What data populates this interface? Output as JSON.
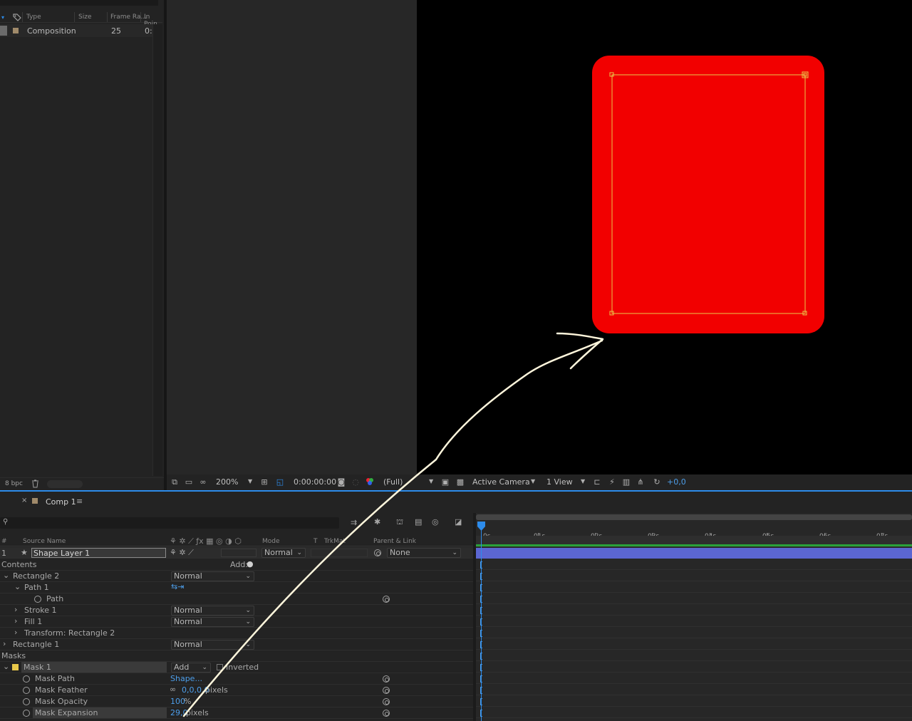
{
  "project": {
    "columns": {
      "type": "Type",
      "size": "Size",
      "frame_rate": "Frame Ra...",
      "in_point": "In Poin"
    },
    "items": [
      {
        "name": "Composition",
        "frame_rate": "25",
        "in_point": "0:"
      }
    ],
    "bpc": "8 bpc"
  },
  "viewer_toolbar": {
    "zoom": "200%",
    "timecode": "0:00:00:00",
    "resolution": "(Full)",
    "camera": "Active Camera",
    "views": "1 View",
    "exposure": "+0,0"
  },
  "timeline": {
    "comp_tab": "Comp 1",
    "columns": {
      "num": "#",
      "source_name": "Source Name",
      "mode": "Mode",
      "t": "T",
      "trkmat": "TrkMat",
      "parent": "Parent & Link"
    },
    "time_ticks": [
      "0s",
      "01s",
      "02s",
      "03s",
      "04s",
      "05s",
      "06s",
      "07s"
    ],
    "layer": {
      "index": "1",
      "name": "Shape Layer 1",
      "mode": "Normal",
      "parent": "None"
    },
    "contents_label": "Contents",
    "add_label": "Add:",
    "rows": {
      "rectangle2": "Rectangle 2",
      "rectangle2_mode": "Normal",
      "path1": "Path 1",
      "path": "Path",
      "stroke1": "Stroke 1",
      "stroke1_mode": "Normal",
      "fill1": "Fill 1",
      "fill1_mode": "Normal",
      "transform": "Transform: Rectangle 2",
      "rectangle1": "Rectangle 1",
      "rectangle1_mode": "Normal"
    },
    "masks_label": "Masks",
    "mask": {
      "name": "Mask 1",
      "mode": "Add",
      "inverted_label": "Inverted",
      "path_label": "Mask Path",
      "path_value": "Shape...",
      "feather_label": "Mask Feather",
      "feather_value": "0,0,0,0",
      "feather_unit": "pixels",
      "opacity_label": "Mask Opacity",
      "opacity_value": "100",
      "opacity_unit": "%",
      "expansion_label": "Mask Expansion",
      "expansion_value": "29,0",
      "expansion_unit": "pixels"
    }
  },
  "colors": {
    "shape_fill": "#f20000",
    "mask_outline": "#e8c84a",
    "accent": "#2d8ceb",
    "layer_bar": "#5b66d1",
    "annotation": "#fff6dc"
  }
}
